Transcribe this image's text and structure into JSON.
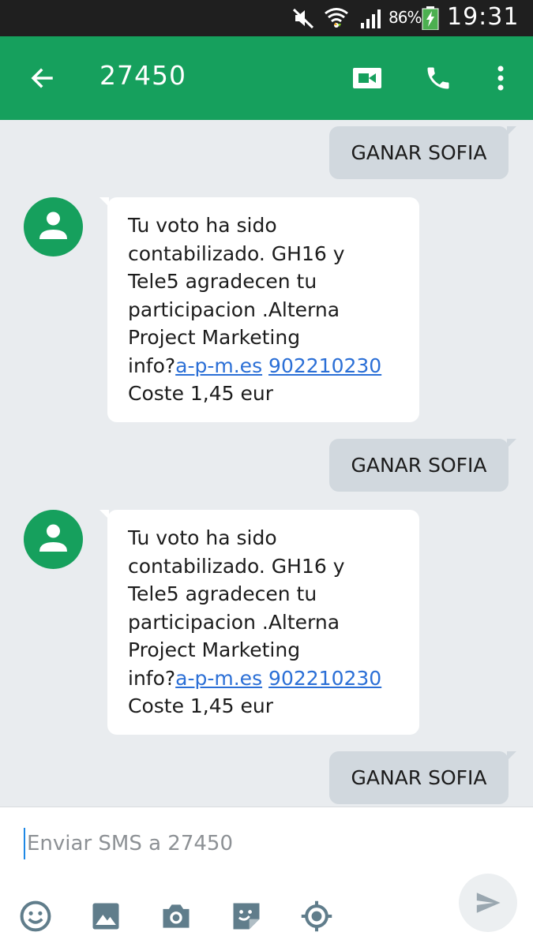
{
  "status_bar": {
    "battery_percent": "86%",
    "time": "19:31",
    "icons": [
      "mute-icon",
      "wifi-icon",
      "signal-icon",
      "battery-charging-icon"
    ]
  },
  "app_bar": {
    "title": "27450",
    "icons": [
      "back-arrow-icon",
      "video-call-icon",
      "phone-icon",
      "more-vert-icon"
    ],
    "accent": "#16a05d"
  },
  "messages": [
    {
      "direction": "out",
      "text": "GANAR SOFIA"
    },
    {
      "direction": "in",
      "lines": [
        "Tu voto ha sido",
        "contabilizado. GH16 y",
        "Tele5 agradecen tu",
        "participacion .Alterna",
        "Project Marketing"
      ],
      "info_prefix": "info?",
      "link_site": "a-p-m.es",
      "link_phone": "902210230",
      "cost": "Coste 1,45 eur"
    },
    {
      "direction": "out",
      "text": "GANAR SOFIA"
    },
    {
      "direction": "in",
      "lines": [
        "Tu voto ha sido",
        "contabilizado. GH16 y",
        "Tele5 agradecen tu",
        "participacion .Alterna",
        "Project Marketing"
      ],
      "info_prefix": "info?",
      "link_site": "a-p-m.es",
      "link_phone": "902210230",
      "cost": "Coste 1,45 eur"
    },
    {
      "direction": "out",
      "text": "GANAR SOFIA"
    }
  ],
  "composer": {
    "placeholder": "Enviar SMS a 27450",
    "tools": [
      "emoji-icon",
      "image-icon",
      "camera-icon",
      "sticker-icon",
      "location-icon"
    ],
    "send_icon": "send-icon"
  }
}
